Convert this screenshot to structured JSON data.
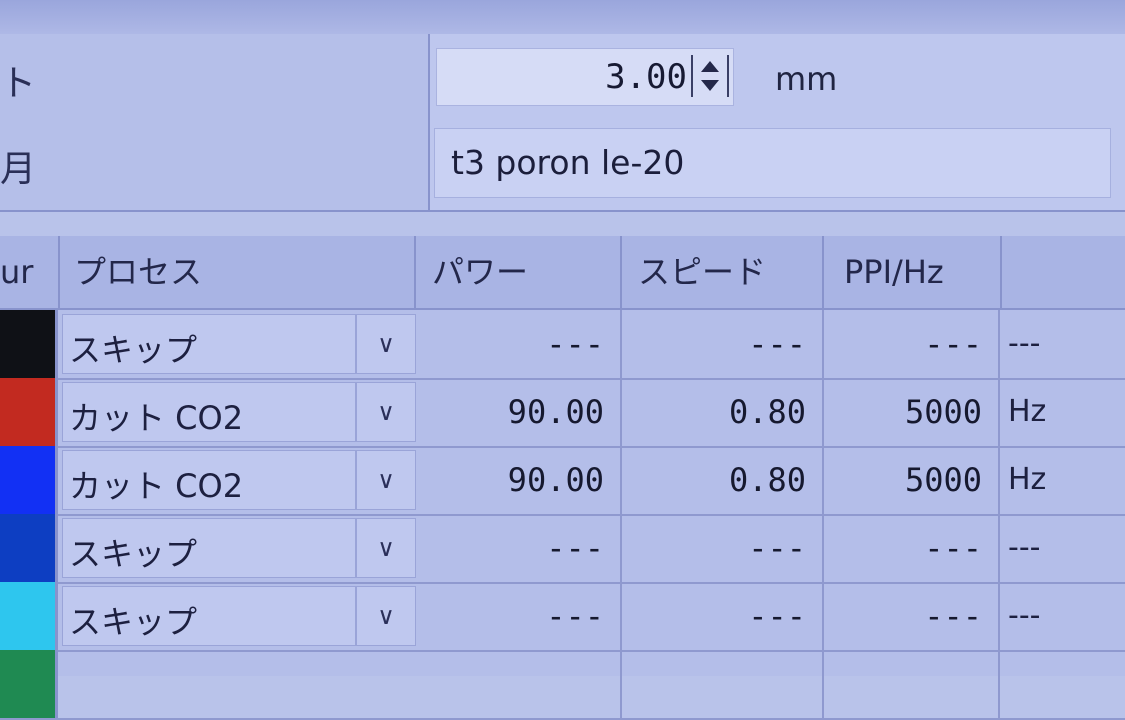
{
  "form": {
    "row1_label_fragment": "ト",
    "thickness_value": "3.00",
    "thickness_unit": "mm",
    "row2_label_fragment": "月",
    "material_value": "t3 poron le-20"
  },
  "table": {
    "headers": {
      "colour": "ur",
      "process": "プロセス",
      "power": "パワー",
      "speed": "スピード",
      "ppi": "PPI/Hz",
      "unit": ""
    },
    "rows": [
      {
        "color": "#0f1116",
        "process": "スキップ",
        "power": "---",
        "speed": "---",
        "ppi": "---",
        "unit": "---"
      },
      {
        "color": "#c22a20",
        "process": "カット CO2",
        "power": "90.00",
        "speed": "0.80",
        "ppi": "5000",
        "unit": "Hz"
      },
      {
        "color": "#1230f4",
        "process": "カット CO2",
        "power": "90.00",
        "speed": "0.80",
        "ppi": "5000",
        "unit": "Hz"
      },
      {
        "color": "#0d3ec2",
        "process": "スキップ",
        "power": "---",
        "speed": "---",
        "ppi": "---",
        "unit": "---"
      },
      {
        "color": "#2ec6ee",
        "process": "スキップ",
        "power": "---",
        "speed": "---",
        "ppi": "---",
        "unit": "---"
      },
      {
        "color": "#1f8a52",
        "process": "",
        "power": "",
        "speed": "",
        "ppi": "",
        "unit": ""
      }
    ]
  },
  "icons": {
    "dropdown": "chevron-down-icon",
    "spinner": "spinner-arrows-icon"
  }
}
